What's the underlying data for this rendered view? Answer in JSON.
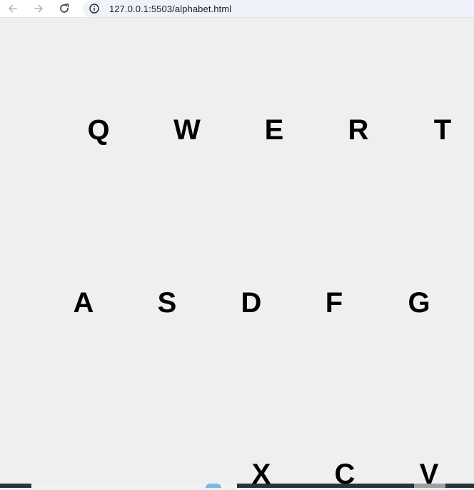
{
  "browser": {
    "back_icon": "arrow-left-icon",
    "forward_icon": "arrow-right-icon",
    "reload_icon": "reload-icon",
    "info_icon": "info-icon",
    "url": "127.0.0.1:5503/alphabet.html"
  },
  "page": {
    "row1": [
      "Q",
      "W",
      "E",
      "R",
      "T"
    ],
    "row2": [
      "A",
      "S",
      "D",
      "F",
      "G"
    ],
    "row3": [
      "X",
      "C",
      "V"
    ]
  },
  "colors": {
    "page_background": "#efefef",
    "letter": "#000000",
    "address_bar_bg": "#eef2fb"
  }
}
